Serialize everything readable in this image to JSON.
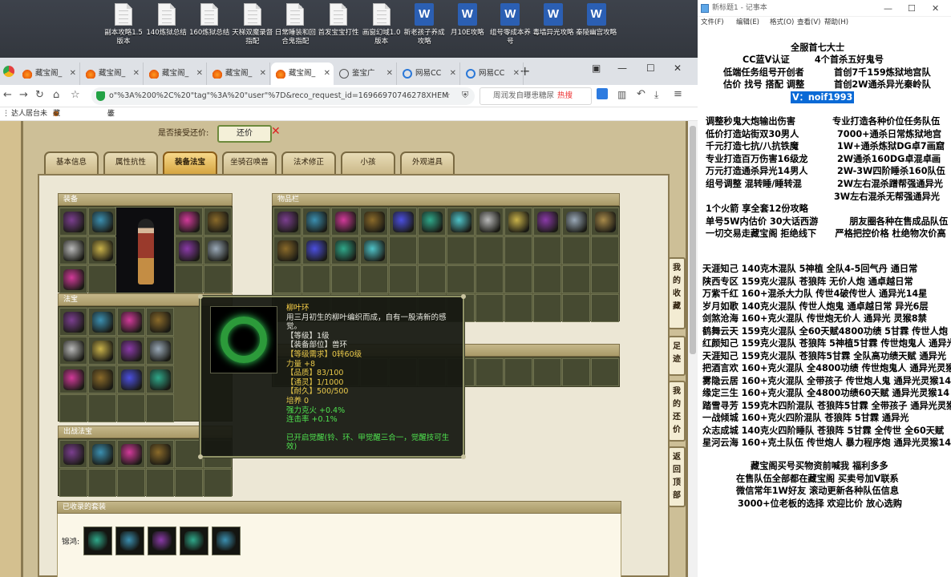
{
  "desktop": {
    "icons": [
      {
        "label": "副本攻略1.5版本",
        "kind": "doc"
      },
      {
        "label": "140炼狱总结",
        "kind": "doc"
      },
      {
        "label": "160炼狱总结",
        "kind": "doc"
      },
      {
        "label": "天梯双魔录督指配",
        "kind": "doc"
      },
      {
        "label": "日常睡装和回合鬼指配",
        "kind": "doc"
      },
      {
        "label": "首发宝宝打性",
        "kind": "doc"
      },
      {
        "label": "画窗幻域1.0版本",
        "kind": "doc"
      },
      {
        "label": "新老孩子养成攻略",
        "kind": "word"
      },
      {
        "label": "月10E攻略",
        "kind": "word"
      },
      {
        "label": "组号零成本养号",
        "kind": "word"
      },
      {
        "label": "毒墙异光攻略",
        "kind": "word"
      },
      {
        "label": "秦陵幽宫攻略",
        "kind": "word"
      }
    ]
  },
  "browser": {
    "tabs": [
      {
        "label": "藏宝阁_",
        "icon": "fire",
        "active": false
      },
      {
        "label": "藏宝阁_",
        "icon": "fire",
        "active": false
      },
      {
        "label": "藏宝阁_",
        "icon": "fire",
        "active": false
      },
      {
        "label": "藏宝阁_",
        "icon": "fire",
        "active": false
      },
      {
        "label": "藏宝阁_",
        "icon": "fire",
        "active": true
      },
      {
        "label": "鉴宝广",
        "icon": "globe",
        "active": false
      },
      {
        "label": "网易CC",
        "icon": "blue",
        "active": false
      },
      {
        "label": "网易CC",
        "icon": "blue",
        "active": false
      }
    ],
    "url": "o\"%3A%200%2C%20\"tag\"%3A%20\"user\"%7D&reco_request_id=16966970746278XHEM",
    "search_text": "周润发自曝患糖尿",
    "search_hot": "热搜",
    "bookmarks": [
      "达人居台未",
      "藏宝阁_",
      "鉴宝广场"
    ]
  },
  "game": {
    "haggle_label": "是否接受还价:",
    "haggle_button": "还价",
    "haggle_x": "✕",
    "tabs": [
      "基本信息",
      "属性抗性",
      "装备法宝",
      "坐骑召唤兽",
      "法术修正",
      "小孩",
      "外观道具"
    ],
    "active_tab": "装备法宝",
    "sections": {
      "equip": "装备",
      "inventory": "物品栏",
      "treasure": "法宝",
      "mounts": "出战法宝",
      "suits": "已收录的套装"
    },
    "suit_label": "锦鸿:",
    "tooltip": {
      "name": "柳叶环",
      "desc": "用三月初生的柳叶编织而成，自有一股清新的感觉。",
      "level": "【等级】1级",
      "part": "【装备部位】兽环",
      "req": "【等级需求】0转60级",
      "strength": "力量 +8",
      "quality": "【品质】83/100",
      "tongling": "【通灵】1/1000",
      "durability": "【耐久】500/500",
      "cultivation": "培养 0",
      "crit_resist": "强力克火 +0.4%",
      "combo": "连击率 +0.1%",
      "awaken": "已开启觉醒(铃、环、甲觉醒三合一，觉醒技可生效)"
    },
    "side_nav": [
      "我的收藏",
      "足迹",
      "我的还价",
      "返回顶部"
    ]
  },
  "notepad": {
    "title": "新标题1 - 记事本",
    "menu": [
      "文件(F)",
      "编辑(E)",
      "格式(O)",
      "查看(V)",
      "帮助(H)"
    ],
    "header_lines": [
      {
        "left": "全服首七大士",
        "right": ""
      },
      {
        "left": "CC蓝V认证 ",
        "right": " 4个首杀五好鬼号"
      },
      {
        "left": "低端任务组号开创者",
        "right": "首创7千159炼狱地宫队"
      },
      {
        "left": "估价 找号 搭配 调整",
        "right": "首创2W通杀异光秦岭队"
      }
    ],
    "contact": "V：noif1993",
    "service_lines": [
      {
        "left": "调整秒鬼大炮输出伤害",
        "right": "专业打造各种价位任务队伍"
      },
      {
        "left": "低价打造站街双30男人",
        "right": "7000+通杀日常炼狱地宫"
      },
      {
        "left": "千元打造七抗/八抗铁魔",
        "right": "1W+通杀炼狱DG卓7画窟"
      },
      {
        "left": "专业打造百万伤害16级龙",
        "right": "2W通杀160DG卓混卓画"
      },
      {
        "left": "万元打造通杀异光14男人",
        "right": "2W-3W四阶睡杀160队伍"
      },
      {
        "left": "组号调整 混转睡/睡转混",
        "right": "2W左右混杀蹭帮强通异光"
      },
      {
        "left": "",
        "right": "3W左右混杀无帮强通异光"
      }
    ],
    "misc_lines": [
      "1个火箭 享全套12份攻略",
      "单号5W内估价 30大话西游          朋友圈各种在售成品队伍",
      "一切交易走藏宝阁 拒绝线下      严格把控价格 杜绝物次价高"
    ],
    "team_lines": [
      "天涯知己 140克木混队 5神植 全队4-5回气丹 通日常",
      "陕西专区 159克火混队 苍狼阵 无价人炮 通卓越日常",
      "万紫千红 160+混杀大力队 传世4破传世人 通异光14星",
      "岁月如歌 140克火混队 传世人炮鬼 通卓越日常 异光6层",
      "剑煞沧海 160+克火混队 传世炮无价人 通异光 灵猴8禁",
      "鹤舞云天 159克火混队 全60天赋4800功绩 5甘霖 传世人炮",
      "红颜知己 159克火混队 苍狼阵 5神植5甘霖 传世炮鬼人 通异光",
      "天涯知己 159克火混队 苍狼阵5甘霖 全队高功绩天赋 通异光",
      "把酒言欢 160+克火混队 全4800功绩 传世炮鬼人 通异光灵猴",
      "雾隐云居 160+克火混队 全带孩子 传世炮人鬼 通异光灵猴14",
      "缘定三生 160+克火混队 全4800功绩60天赋 通异光灵猴14",
      "踏雪寻芳 159克木四阶混队 苍狼阵5甘霖 全带孩子 通异光灵猴",
      "一战倾城 160+克火四阶混队 苍狼阵 5甘霖 通异光",
      "众志成城 140克火四阶睡队 苍狼阵 5甘霖 全传世 全60天赋",
      "星河云海 160+克土队伍 传世炮人 暴力程序炮 通异光灵猴14"
    ],
    "footer_lines": [
      "藏宝阁买号买物资前喊我 福利多多",
      "在售队伍全部都在藏宝阁 买卖号加V联系",
      "微信常年1W好友 滚动更新各种队伍信息",
      "3000+位老板的选择 欢迎比价 放心选购"
    ]
  },
  "colors": {
    "desktop": "#33373e",
    "game_bg": "#cdbf97",
    "item_colors": [
      "#7b3f8f",
      "#2fa88a",
      "#9aa9b8",
      "#8a6a2a",
      "#c9b24a",
      "#3b8fb0",
      "#4fc3c9",
      "#a88a4a",
      "#4b4fe0",
      "#8a3aa8",
      "#d23a9a",
      "#b9b9b9"
    ]
  }
}
